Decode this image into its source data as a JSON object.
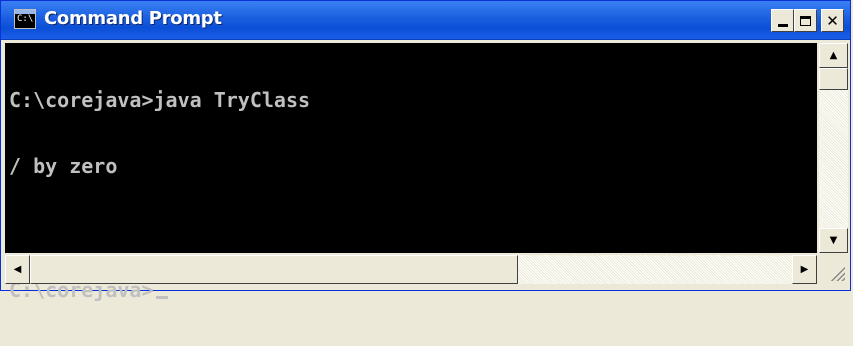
{
  "window": {
    "title": "Command Prompt",
    "icon_text": "C:\\",
    "icon": "console-icon",
    "controls": {
      "minimize_icon": "minimize-icon",
      "maximize_icon": "maximize-icon",
      "close_icon": "close-icon",
      "close_glyph": "✕"
    }
  },
  "console": {
    "lines": {
      "l1": "C:\\corejava>java TryClass",
      "l2": "/ by zero",
      "l3": "C:\\corejava>"
    }
  },
  "scrollbars": {
    "up_glyph": "▲",
    "down_glyph": "▼",
    "left_glyph": "◀",
    "right_glyph": "▶"
  },
  "colors": {
    "titlebar": "#0b4fd6",
    "console_bg": "#000000",
    "console_text": "#c0c0c0"
  }
}
